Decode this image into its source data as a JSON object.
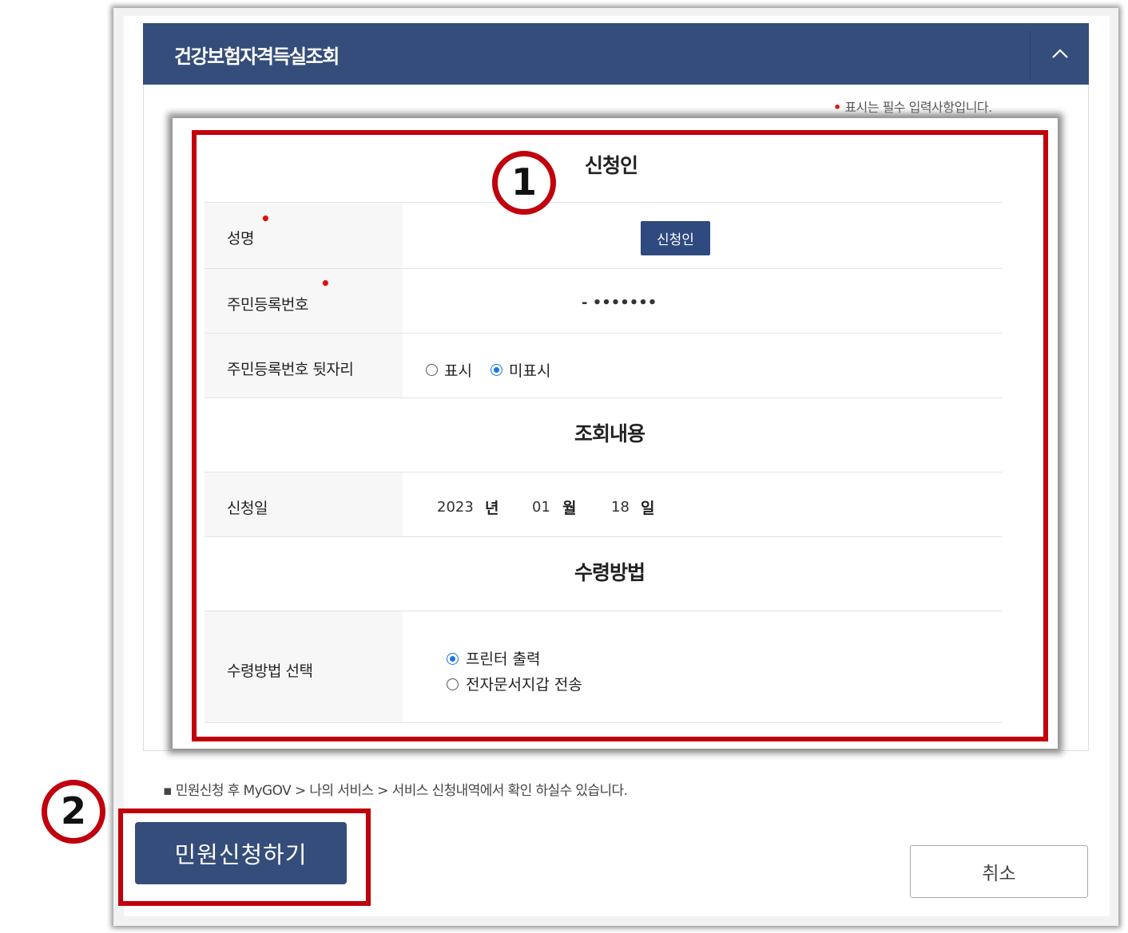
{
  "header": {
    "title": "건강보험자격득실조회",
    "collapse_icon": "chevron-up-icon"
  },
  "required_note": {
    "marker": "•",
    "text": "표시는 필수 입력사항입니다."
  },
  "sections": {
    "applicant_title": "신청인",
    "inquiry_title": "조회내용",
    "receipt_title": "수령방법"
  },
  "fields": {
    "name_label": "성명",
    "name_button": "신청인",
    "rrn_label": "주민등록번호",
    "rrn_value": "- •••••••",
    "rrn_back_label": "주민등록번호 뒷자리",
    "rrn_back_options": [
      "표시",
      "미표시"
    ],
    "rrn_back_selected": "미표시",
    "date_label": "신청일",
    "date_year": "2023",
    "date_year_unit": "년",
    "date_month": "01",
    "date_month_unit": "월",
    "date_day": "18",
    "date_day_unit": "일",
    "receipt_label": "수령방법 선택",
    "receipt_options": [
      "프린터 출력",
      "전자문서지갑 전송"
    ],
    "receipt_selected": "프린터 출력"
  },
  "notice": "▪ 민원신청 후 MyGOV > 나의 서비스 > 서비스 신청내역에서 확인 하실수 있습니다.",
  "buttons": {
    "submit": "민원신청하기",
    "cancel": "취소"
  },
  "annotations": {
    "badge1": "1",
    "badge2": "2"
  },
  "colors": {
    "header": "#354d7a",
    "highlight": "#c0000c",
    "radio": "#1a73e8"
  }
}
